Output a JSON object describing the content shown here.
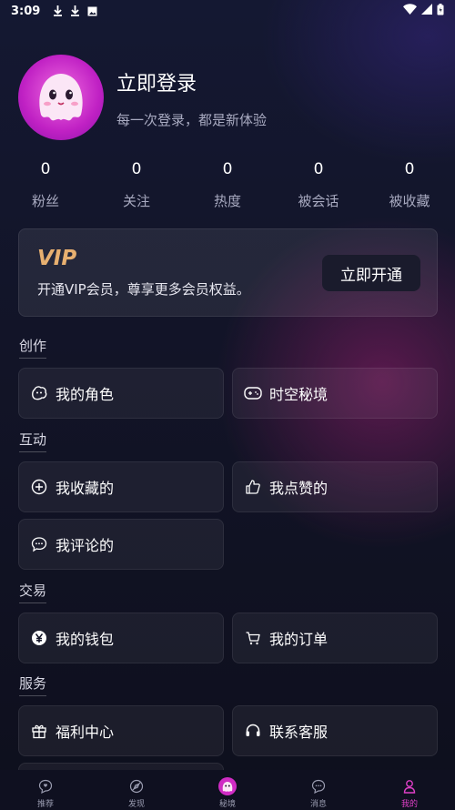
{
  "status_bar": {
    "time": "3:09"
  },
  "profile": {
    "title": "立即登录",
    "subtitle": "每一次登录，都是新体验"
  },
  "stats": [
    {
      "value": "0",
      "label": "粉丝"
    },
    {
      "value": "0",
      "label": "关注"
    },
    {
      "value": "0",
      "label": "热度"
    },
    {
      "value": "0",
      "label": "被会话"
    },
    {
      "value": "0",
      "label": "被收藏"
    }
  ],
  "vip": {
    "logo": "VIP",
    "description": "开通VIP会员，尊享更多会员权益。",
    "button": "立即开通"
  },
  "sections": {
    "create": {
      "title": "创作",
      "items": [
        {
          "label": "我的角色",
          "icon": "character-icon"
        },
        {
          "label": "时空秘境",
          "icon": "gamepad-icon"
        }
      ]
    },
    "interact": {
      "title": "互动",
      "items": [
        {
          "label": "我收藏的",
          "icon": "plus-circle-icon"
        },
        {
          "label": "我点赞的",
          "icon": "thumbs-up-icon"
        },
        {
          "label": "我评论的",
          "icon": "comment-icon"
        }
      ]
    },
    "trade": {
      "title": "交易",
      "items": [
        {
          "label": "我的钱包",
          "icon": "yen-icon"
        },
        {
          "label": "我的订单",
          "icon": "cart-icon"
        }
      ]
    },
    "service": {
      "title": "服务",
      "items": [
        {
          "label": "福利中心",
          "icon": "gift-icon"
        },
        {
          "label": "联系客服",
          "icon": "headset-icon"
        }
      ]
    }
  },
  "tabbar": [
    {
      "label": "推荐",
      "icon": "recommend-icon",
      "active": false
    },
    {
      "label": "发现",
      "icon": "discover-icon",
      "active": false
    },
    {
      "label": "秘境",
      "icon": "ghost-icon",
      "active": false
    },
    {
      "label": "消息",
      "icon": "message-icon",
      "active": false
    },
    {
      "label": "我的",
      "icon": "profile-icon",
      "active": true
    }
  ],
  "colors": {
    "accent": "#e040c8",
    "vip_gold": "#e8b070",
    "avatar": "#c021c4"
  }
}
